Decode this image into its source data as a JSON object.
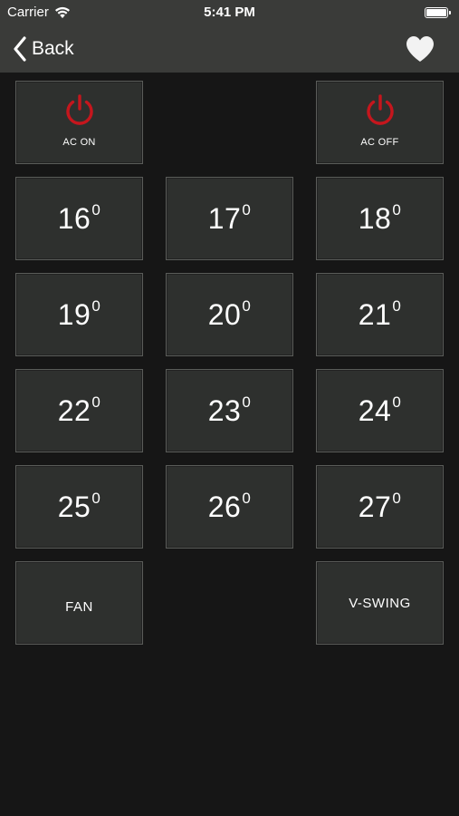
{
  "status_bar": {
    "carrier": "Carrier",
    "time": "5:41 PM"
  },
  "nav": {
    "back_label": "Back",
    "favorite_icon": "heart-icon"
  },
  "colors": {
    "background": "#161616",
    "bar": "#3a3b39",
    "button": "#2e302e",
    "power_icon": "#c5161d"
  },
  "buttons": {
    "ac_on": "AC ON",
    "ac_off": "AC OFF",
    "fan": "FAN",
    "v_swing": "V-SWING",
    "degree_mark": "0"
  },
  "temperatures": [
    "16",
    "17",
    "18",
    "19",
    "20",
    "21",
    "22",
    "23",
    "24",
    "25",
    "26",
    "27"
  ]
}
